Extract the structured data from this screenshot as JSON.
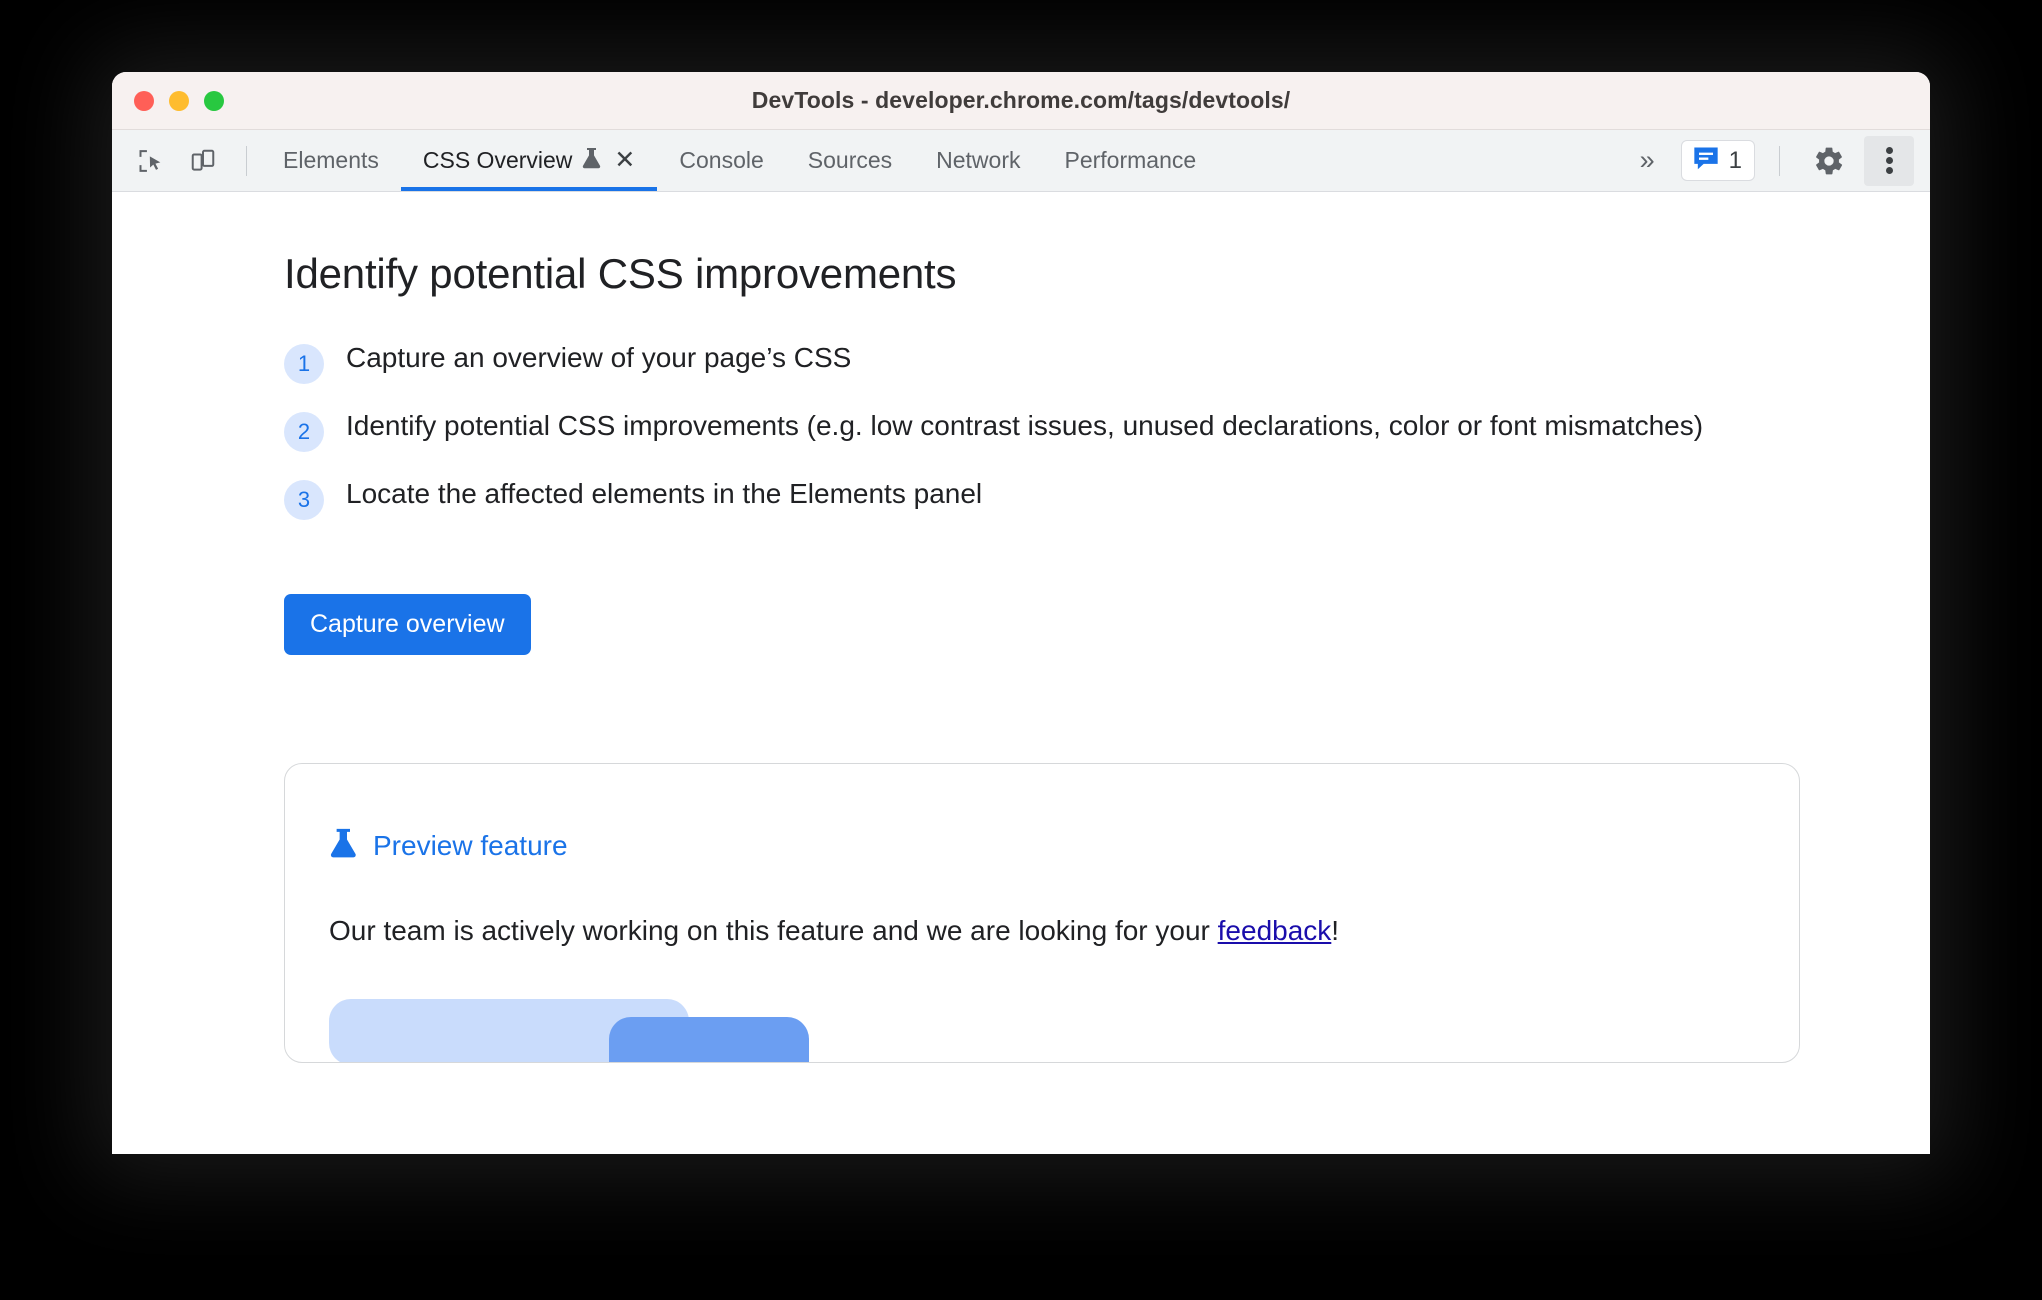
{
  "window": {
    "title": "DevTools - developer.chrome.com/tags/devtools/",
    "traffic_lights": [
      "close",
      "minimize",
      "maximize"
    ]
  },
  "toolbar": {
    "inspect_icon": "inspect-element-icon",
    "device_icon": "device-toolbar-icon",
    "overflow_label": "»",
    "issues_count": "1",
    "issues_icon": "issues-message-icon",
    "settings_icon": "gear-icon",
    "more_icon": "kebab-menu-icon",
    "tabs": [
      {
        "label": "Elements",
        "active": false,
        "flask": false,
        "closeable": false
      },
      {
        "label": "CSS Overview",
        "active": true,
        "flask": true,
        "closeable": true,
        "close_label": "✕"
      },
      {
        "label": "Console",
        "active": false,
        "flask": false,
        "closeable": false
      },
      {
        "label": "Sources",
        "active": false,
        "flask": false,
        "closeable": false
      },
      {
        "label": "Network",
        "active": false,
        "flask": false,
        "closeable": false
      },
      {
        "label": "Performance",
        "active": false,
        "flask": false,
        "closeable": false
      }
    ]
  },
  "panel": {
    "heading": "Identify potential CSS improvements",
    "steps": [
      {
        "number": "1",
        "text": "Capture an overview of your page’s CSS"
      },
      {
        "number": "2",
        "text": "Identify potential CSS improvements (e.g. low contrast issues, unused declarations, color or font mismatches)"
      },
      {
        "number": "3",
        "text": "Locate the affected elements in the Elements panel"
      }
    ],
    "capture_button": "Capture overview"
  },
  "preview_card": {
    "flask_icon": "flask-icon",
    "title": "Preview feature",
    "body_before_link": "Our team is actively working on this feature and we are looking for your ",
    "link_text": "feedback",
    "body_after_link": "!",
    "action_primary": "",
    "action_secondary": ""
  },
  "colors": {
    "accent_blue": "#1a73e8",
    "link_blue": "#1a0dab",
    "badge_bg": "#d9e6fd",
    "titlebar_bg": "#f7f1f0",
    "tabstrip_bg": "#f1f3f4",
    "text_primary": "#202124",
    "text_secondary": "#5f6368"
  }
}
